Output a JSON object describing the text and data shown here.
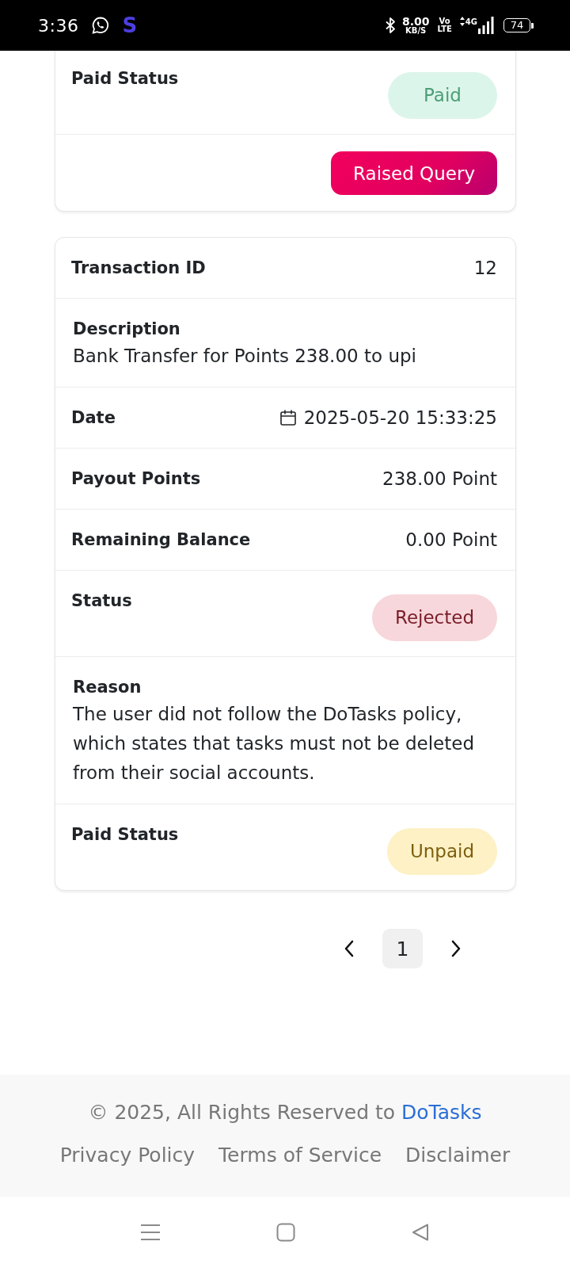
{
  "status_bar": {
    "time": "3:36",
    "app_letter": "S",
    "net_speed": "8.00",
    "net_speed_unit": "KB/S",
    "volte_top": "Vo",
    "volte_bottom": "LTE",
    "network_type": "4G",
    "battery": "74"
  },
  "transactions": [
    {
      "rows": [
        {
          "kind": "badge",
          "label": "Paid Status",
          "badge": {
            "text": "Paid",
            "kind": "success"
          }
        }
      ],
      "action": {
        "label": "Raised Query"
      }
    },
    {
      "rows": [
        {
          "kind": "pair",
          "label": "Transaction ID",
          "value": "12"
        },
        {
          "kind": "text",
          "label": "Description",
          "value": "Bank Transfer for Points 238.00 to upi"
        },
        {
          "kind": "date",
          "label": "Date",
          "value": "2025-05-20 15:33:25"
        },
        {
          "kind": "pair",
          "label": "Payout Points",
          "value": "238.00 Point"
        },
        {
          "kind": "pair",
          "label": "Remaining Balance",
          "value": "0.00 Point"
        },
        {
          "kind": "badge",
          "label": "Status",
          "badge": {
            "text": "Rejected",
            "kind": "danger"
          }
        },
        {
          "kind": "text",
          "label": "Reason",
          "value": "The user did not follow the DoTasks policy, which states that tasks must not be deleted from their social accounts."
        },
        {
          "kind": "badge",
          "label": "Paid Status",
          "badge": {
            "text": "Unpaid",
            "kind": "warning"
          }
        }
      ]
    }
  ],
  "pagination": {
    "pages": [
      {
        "label": "1",
        "selected": true
      }
    ]
  },
  "footer": {
    "copyright": "© 2025, All Rights Reserved to",
    "brand_link": "DoTasks",
    "links": [
      "Privacy Policy",
      "Terms of Service",
      "Disclaimer"
    ]
  }
}
